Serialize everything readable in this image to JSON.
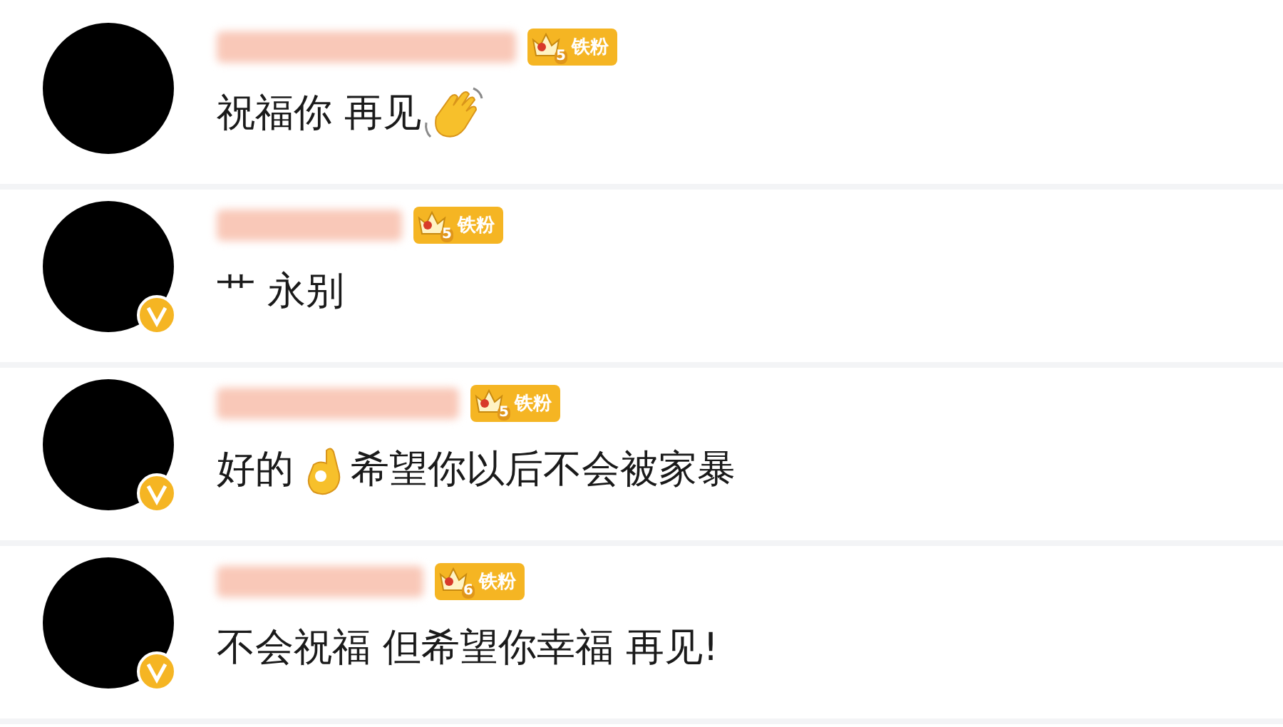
{
  "comments": [
    {
      "verified": false,
      "badge": {
        "level": "5",
        "label": "铁粉"
      },
      "parts": [
        {
          "kind": "text",
          "text": "祝福你 再见"
        },
        {
          "kind": "wave_emoji"
        }
      ]
    },
    {
      "verified": true,
      "badge": {
        "level": "5",
        "label": "铁粉"
      },
      "parts": [
        {
          "kind": "text",
          "text": "艹 永别"
        }
      ]
    },
    {
      "verified": true,
      "badge": {
        "level": "5",
        "label": "铁粉"
      },
      "parts": [
        {
          "kind": "text",
          "text": "好的"
        },
        {
          "kind": "ok_emoji"
        },
        {
          "kind": "text",
          "text": "希望你以后不会被家暴"
        }
      ]
    },
    {
      "verified": true,
      "badge": {
        "level": "6",
        "label": "铁粉"
      },
      "parts": [
        {
          "kind": "text",
          "text": "不会祝福 但希望你幸福 再见!"
        }
      ]
    }
  ]
}
